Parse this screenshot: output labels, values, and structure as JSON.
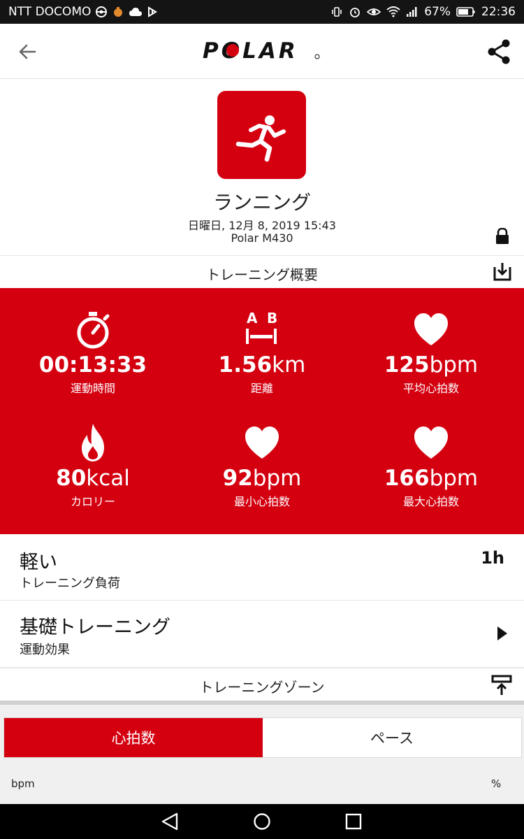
{
  "status_bar": {
    "carrier": "NTT DOCOMO",
    "battery": "67%",
    "time": "22:36"
  },
  "app_bar": {
    "logo_text": "POLAR"
  },
  "session": {
    "sport_name": "ランニング",
    "datetime": "日曜日, 12月 8, 2019 15:43",
    "device": "Polar M430"
  },
  "summary": {
    "section_title": "トレーニング概要",
    "stats": [
      {
        "icon": "stopwatch-icon",
        "number": "00:13:33",
        "unit": "",
        "label": "運動時間"
      },
      {
        "icon": "distance-ab-icon",
        "number": "1.56",
        "unit": "km",
        "label": "距離"
      },
      {
        "icon": "heart-icon",
        "number": "125",
        "unit": "bpm",
        "label": "平均心拍数"
      },
      {
        "icon": "flame-icon",
        "number": "80",
        "unit": "kcal",
        "label": "カロリー"
      },
      {
        "icon": "heart-icon",
        "number": "92",
        "unit": "bpm",
        "label": "最小心拍数"
      },
      {
        "icon": "heart-icon",
        "number": "166",
        "unit": "bpm",
        "label": "最大心拍数"
      }
    ]
  },
  "training_load": {
    "value": "軽い",
    "label": "トレーニング負荷",
    "recovery": "1h"
  },
  "training_benefit": {
    "value": "基礎トレーニング",
    "label": "運動効果"
  },
  "zones": {
    "section_title": "トレーニングゾーン",
    "tabs": [
      "心拍数",
      "ペース"
    ],
    "active_tab": 0,
    "left_axis_label": "bpm",
    "right_axis_label": "%"
  },
  "colors": {
    "polar_red": "#d40010",
    "status_bar_bg": "#141414",
    "nav_bar_bg": "#000000"
  }
}
